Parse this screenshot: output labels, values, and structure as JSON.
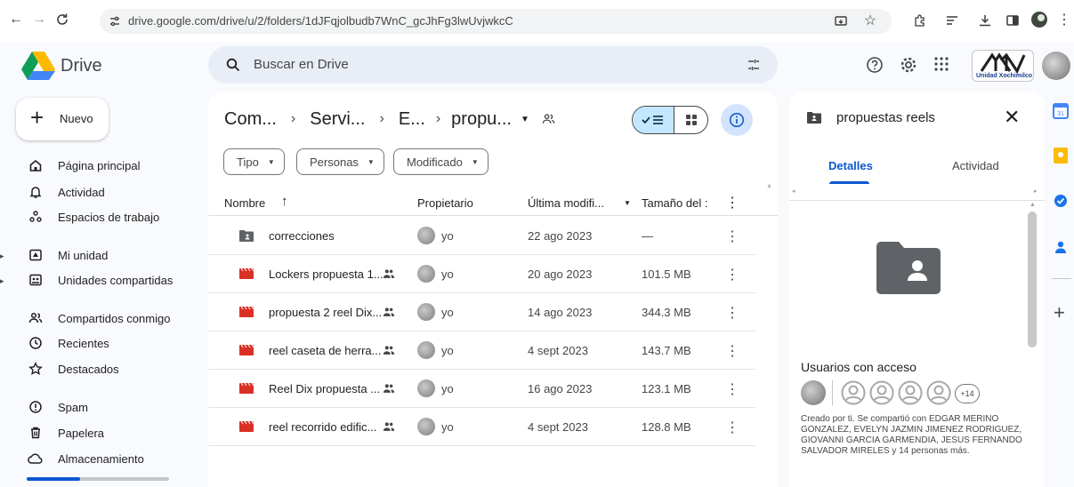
{
  "browser": {
    "url": "drive.google.com/drive/u/2/folders/1dJFqjolbudb7WnC_gcJhFg3lwUvjwkcC"
  },
  "app": {
    "name": "Drive",
    "search_placeholder": "Buscar en Drive",
    "org_logo_text": "Unidad Xochimilco"
  },
  "nav": {
    "new_label": "Nuevo",
    "items": [
      {
        "label": "Página principal",
        "icon": "home-icon"
      },
      {
        "label": "Actividad",
        "icon": "bell-icon"
      },
      {
        "label": "Espacios de trabajo",
        "icon": "workspaces-icon"
      },
      {
        "label": "Mi unidad",
        "icon": "my-drive-icon"
      },
      {
        "label": "Unidades compartidas",
        "icon": "shared-drives-icon"
      },
      {
        "label": "Compartidos conmigo",
        "icon": "people-icon"
      },
      {
        "label": "Recientes",
        "icon": "clock-icon"
      },
      {
        "label": "Destacados",
        "icon": "star-icon"
      },
      {
        "label": "Spam",
        "icon": "spam-icon"
      },
      {
        "label": "Papelera",
        "icon": "trash-icon"
      },
      {
        "label": "Almacenamiento",
        "icon": "cloud-icon"
      }
    ]
  },
  "breadcrumbs": [
    "Com...",
    "Servi...",
    "E...",
    "propu..."
  ],
  "filters": [
    "Tipo",
    "Personas",
    "Modificado"
  ],
  "table": {
    "columns": {
      "name": "Nombre",
      "owner": "Propietario",
      "modified": "Última modifi...",
      "size": "Tamaño del :"
    },
    "rows": [
      {
        "name": "correcciones",
        "type": "folder",
        "shared": false,
        "owner": "yo",
        "modified": "22 ago 2023",
        "size": "—"
      },
      {
        "name": "Lockers propuesta 1...",
        "type": "video",
        "shared": true,
        "owner": "yo",
        "modified": "20 ago 2023",
        "size": "101.5 MB"
      },
      {
        "name": "propuesta 2 reel Dix...",
        "type": "video",
        "shared": true,
        "owner": "yo",
        "modified": "14 ago 2023",
        "size": "344.3 MB"
      },
      {
        "name": "reel caseta de herra...",
        "type": "video",
        "shared": true,
        "owner": "yo",
        "modified": "4 sept 2023",
        "size": "143.7 MB"
      },
      {
        "name": "Reel Dix propuesta ...",
        "type": "video",
        "shared": true,
        "owner": "yo",
        "modified": "16 ago 2023",
        "size": "123.1 MB"
      },
      {
        "name": "reel recorrido edific...",
        "type": "video",
        "shared": true,
        "owner": "yo",
        "modified": "4 sept 2023",
        "size": "128.8 MB"
      }
    ]
  },
  "details": {
    "title": "propuestas reels",
    "tab_details": "Detalles",
    "tab_activity": "Actividad",
    "users_title": "Usuarios con acceso",
    "more_users": "+14",
    "share_text": "Creado por ti. Se compartió con EDGAR MERINO GONZALEZ, EVELYN JAZMIN JIMENEZ RODRIGUEZ, GIOVANNI GARCIA GARMENDIA, JESUS FERNANDO SALVADOR MIRELES y 14 personas más."
  },
  "colors": {
    "accent": "#0b57d0",
    "video_red": "#d93025",
    "folder_gray": "#5f6368",
    "view_toggle_bg": "#c2e7ff",
    "info_btn_bg": "#d3e3fd"
  }
}
